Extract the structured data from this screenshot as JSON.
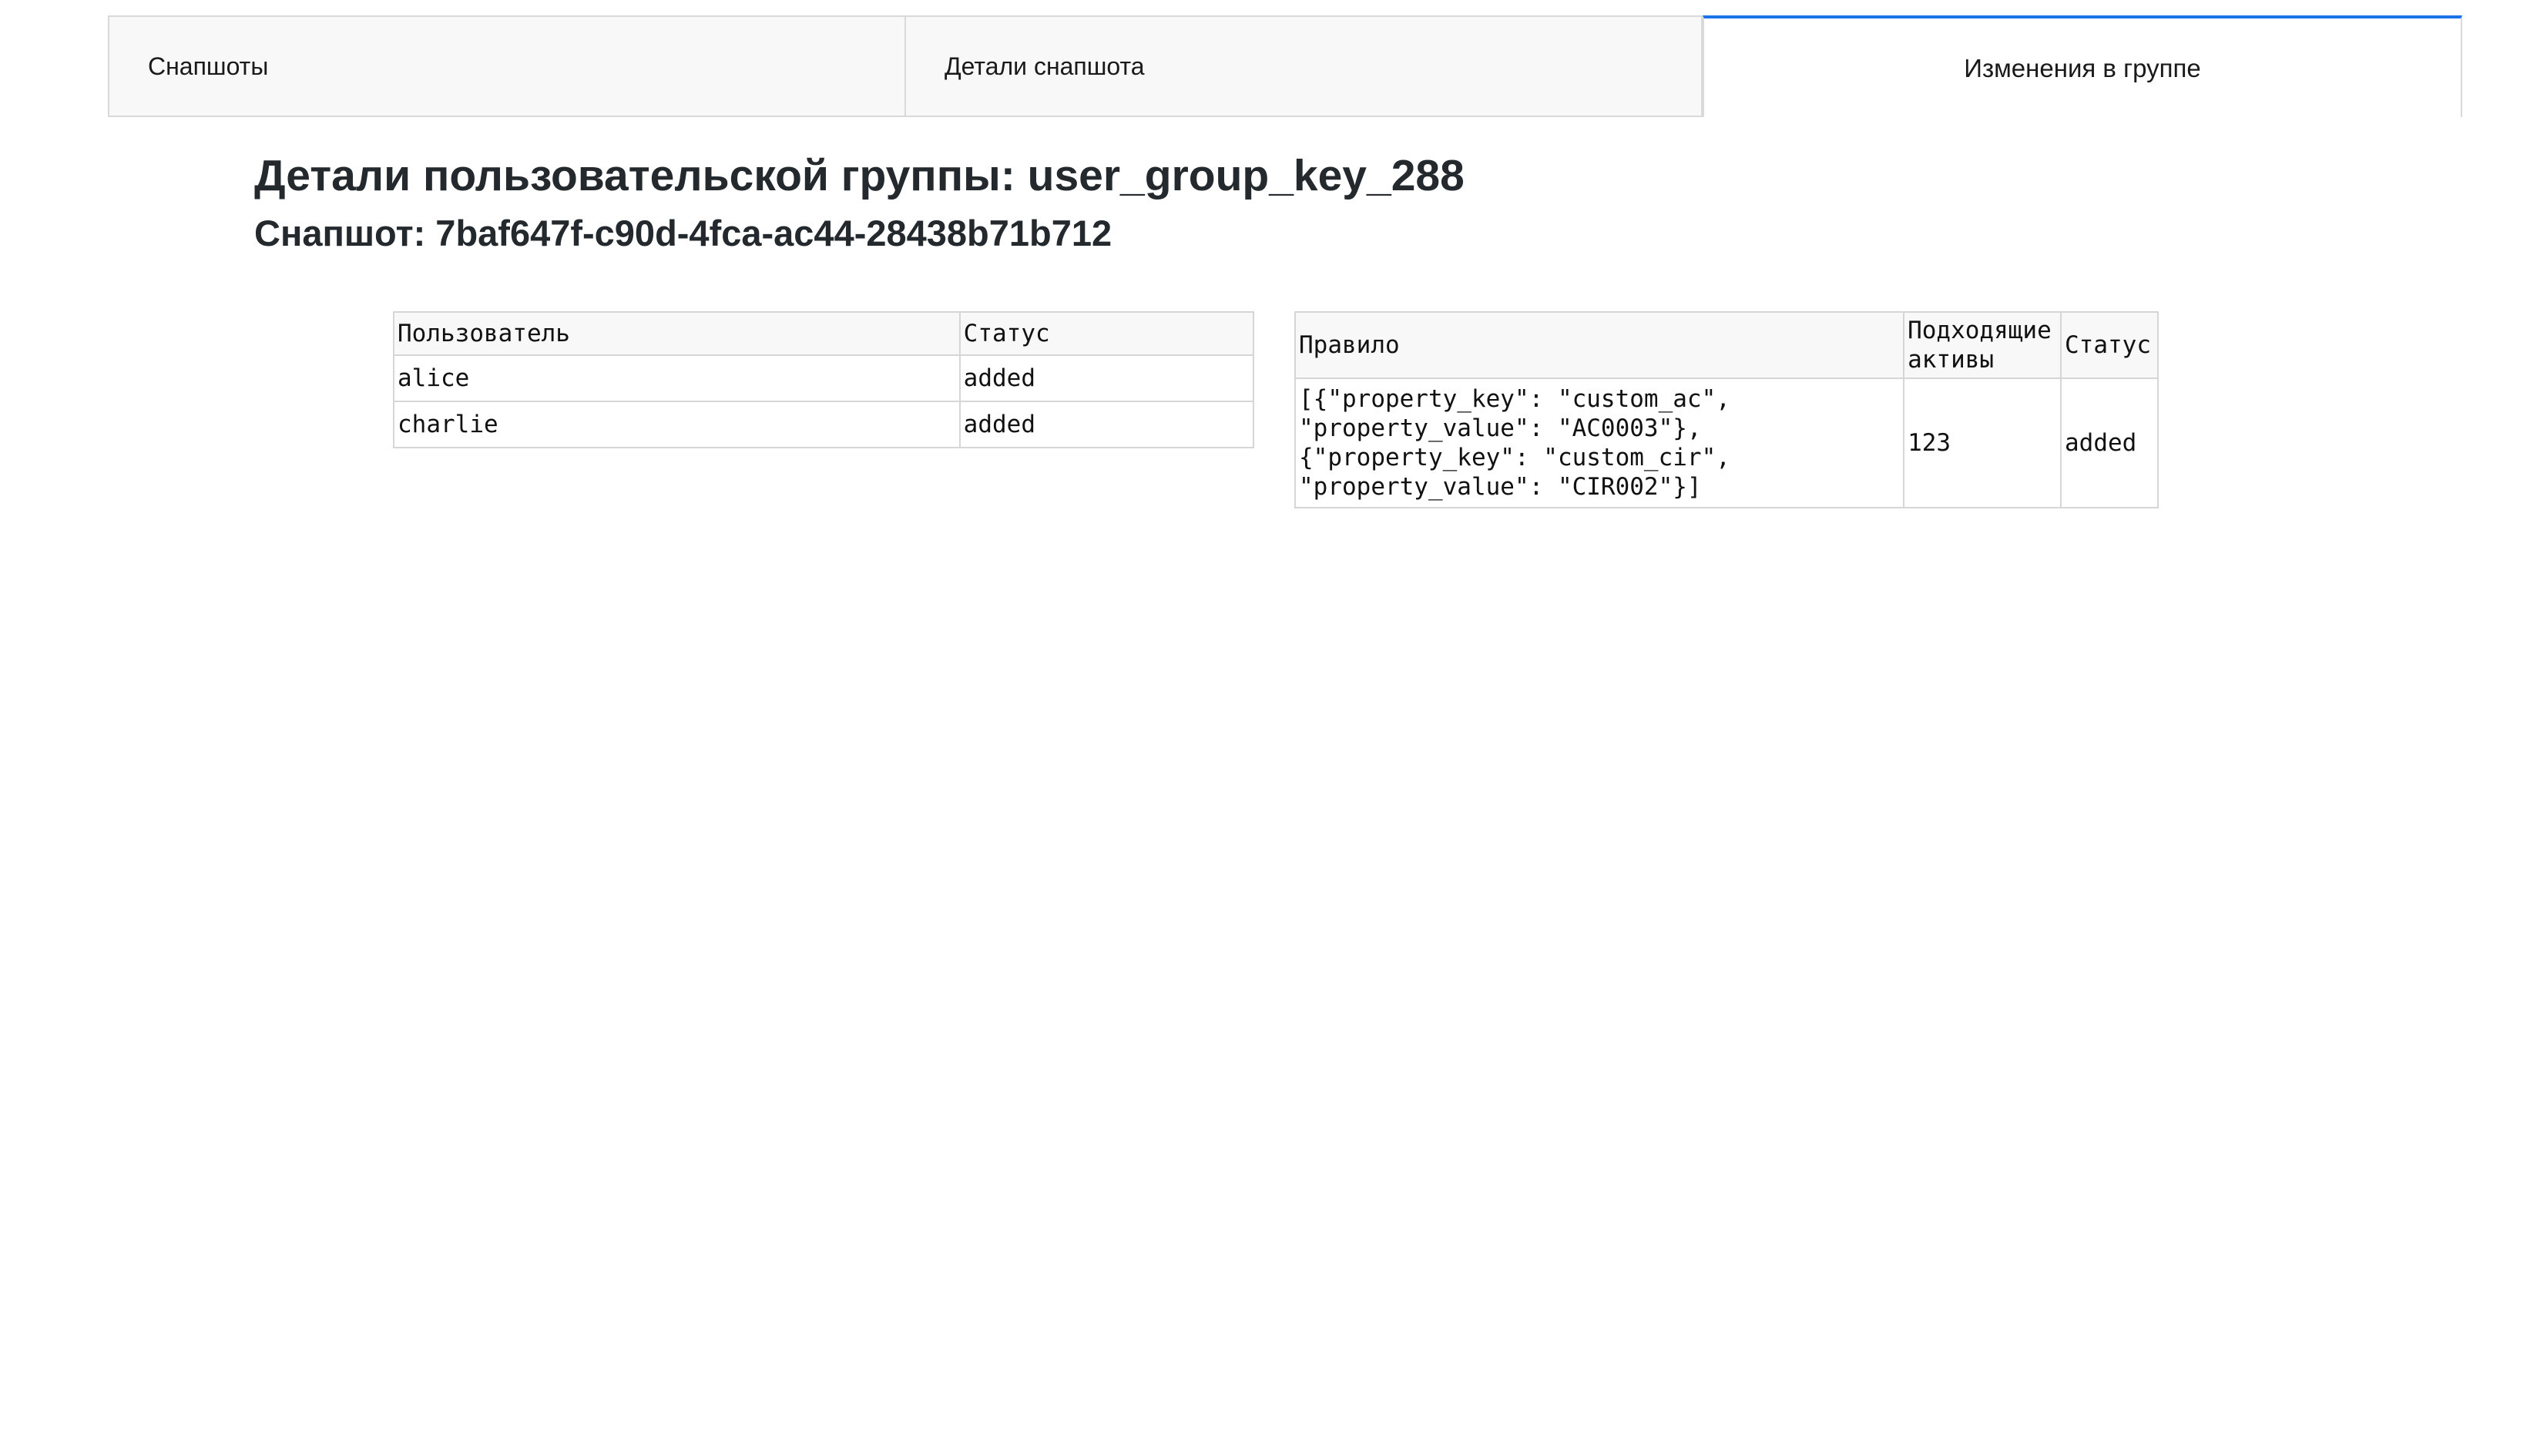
{
  "tabs": [
    {
      "label": "Снапшоты",
      "active": false
    },
    {
      "label": "Детали снапшота",
      "active": false
    },
    {
      "label": "Изменения в группе",
      "active": true
    }
  ],
  "colors": {
    "accent": "#1a73e8",
    "tab_background": "#f8f8f8",
    "border": "#d9d9d9"
  },
  "page": {
    "title": "Детали пользовательской группы: user_group_key_288",
    "snapshot": "Снапшот: 7baf647f-c90d-4fca-ac44-28438b71b712"
  },
  "users_table": {
    "headers": [
      "Пользователь",
      "Статус"
    ],
    "rows": [
      [
        "alice",
        "added"
      ],
      [
        "charlie",
        "added"
      ]
    ]
  },
  "rules_table": {
    "headers": [
      "Правило",
      "Подходящие активы",
      "Статус"
    ],
    "rows": [
      [
        "[{\"property_key\": \"custom_ac\",\n\"property_value\": \"AC0003\"},\n{\"property_key\": \"custom_cir\",\n\"property_value\": \"CIR002\"}]",
        "123",
        "added"
      ]
    ]
  }
}
